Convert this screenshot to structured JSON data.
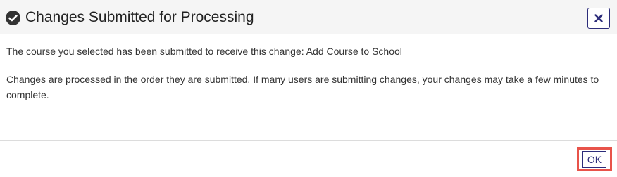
{
  "dialog": {
    "title": "Changes Submitted for Processing",
    "title_icon": "check-circle-icon",
    "close_icon": "close-icon",
    "close_label": "Close",
    "message_line1": "The course you selected has been submitted to receive this change: Add Course to School",
    "message_line2": "Changes are processed in the order they are submitted. If many users are submitting changes, your changes may take a few minutes to complete.",
    "ok_label": "OK"
  },
  "colors": {
    "header_bg": "#f5f5f5",
    "accent_navy": "#2c2c7a",
    "highlight_red": "#e8534a",
    "divider": "#dcdcdc"
  }
}
